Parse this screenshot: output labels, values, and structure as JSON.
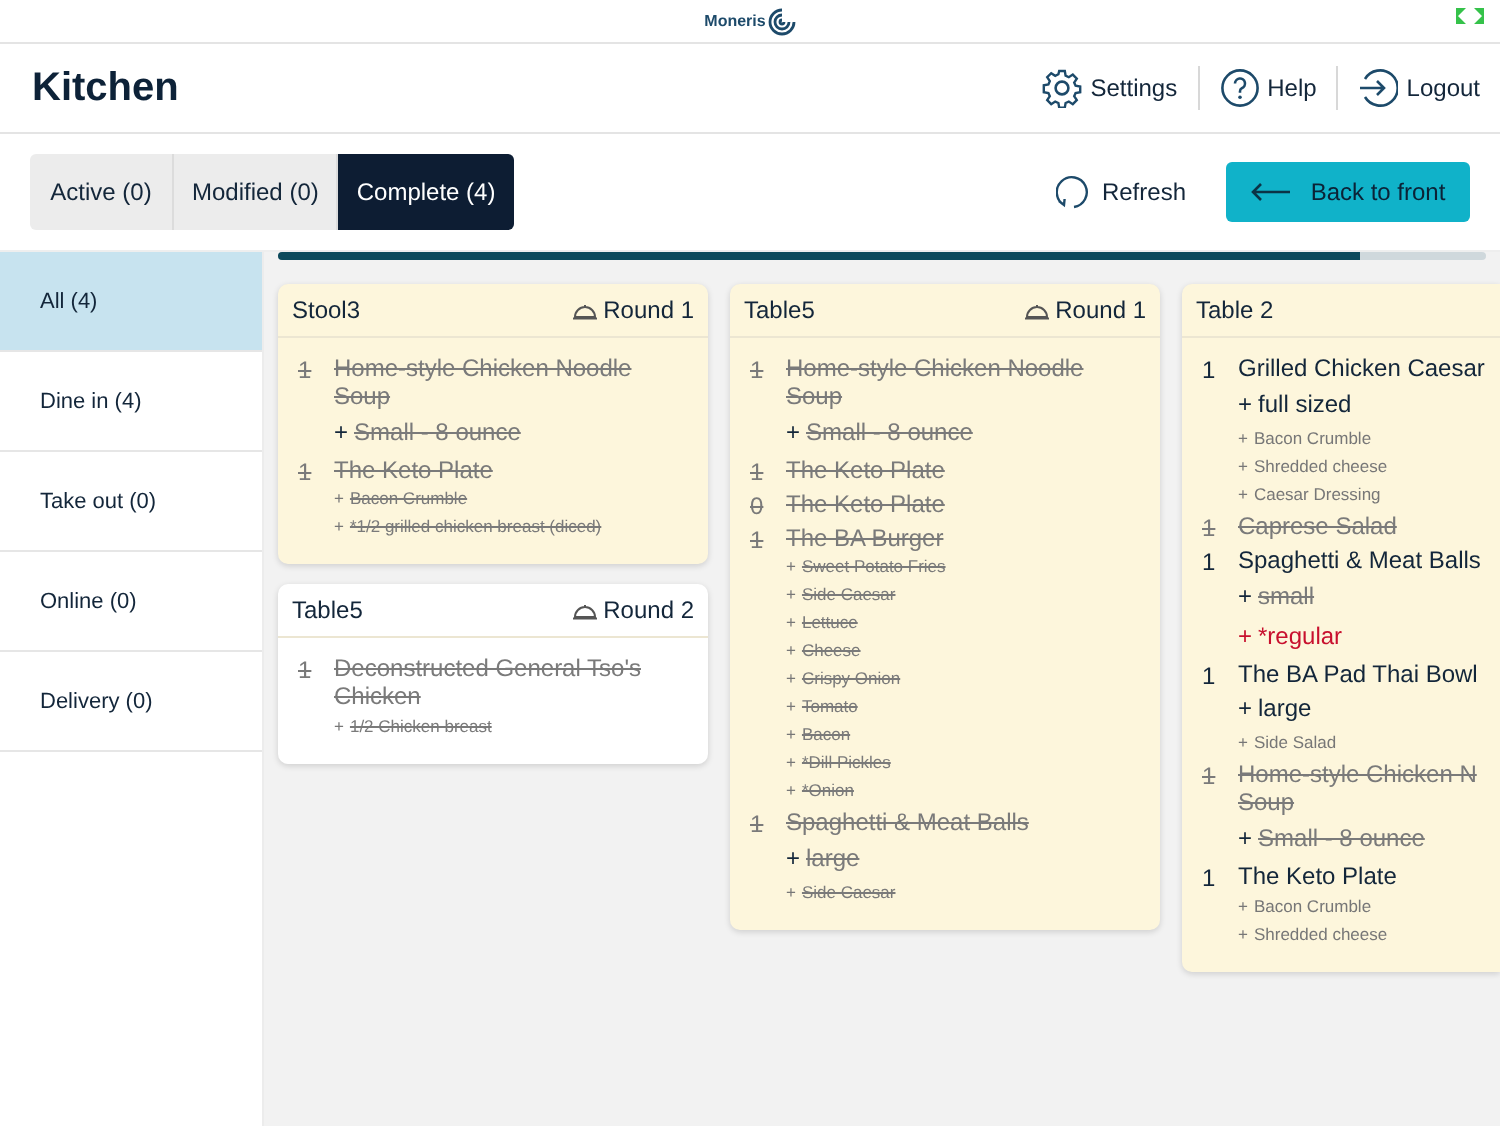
{
  "top_bar": {
    "brand": "Moneris"
  },
  "header": {
    "title": "Kitchen",
    "actions": [
      {
        "kind": "settings",
        "label": "Settings"
      },
      {
        "kind": "help",
        "label": "Help"
      },
      {
        "kind": "logout",
        "label": "Logout"
      }
    ]
  },
  "tabs": [
    {
      "label": "Active (0)",
      "selected": false
    },
    {
      "label": "Modified (0)",
      "selected": false
    },
    {
      "label": "Complete (4)",
      "selected": true
    }
  ],
  "refresh": {
    "label": "Refresh"
  },
  "back_button": {
    "label": "Back to front"
  },
  "progress": {
    "level": 0.895
  },
  "sidebar": {
    "items": [
      {
        "label": "All (4)",
        "selected": true
      },
      {
        "label": "Dine in (4)",
        "selected": false
      },
      {
        "label": "Take out (0)",
        "selected": false
      },
      {
        "label": "Online (0)",
        "selected": false
      },
      {
        "label": "Delivery (0)",
        "selected": false
      }
    ]
  },
  "columns": [
    {
      "cards": [
        {
          "title": "Stool3",
          "round": "Round 1",
          "highlighted": true,
          "items": [
            {
              "qty": "1",
              "name": "Home-style Chicken Noodle Soup",
              "struck": true,
              "modifiers": [
                {
                  "prefix": "+",
                  "text": "Small - 8 ounce",
                  "kind": "variant",
                  "struck": true
                }
              ]
            },
            {
              "qty": "1",
              "name": "The Keto Plate",
              "struck": true,
              "modifiers": [
                {
                  "prefix": "+",
                  "text": "Bacon Crumble",
                  "kind": "option",
                  "struck": true
                },
                {
                  "prefix": "+",
                  "text": "*1/2 grilled chicken breast (diced)",
                  "kind": "option",
                  "struck": true
                }
              ]
            }
          ]
        },
        {
          "title": "Table5",
          "round": "Round 2",
          "highlighted": false,
          "items": [
            {
              "qty": "1",
              "name": "Deconstructed General Tso's Chicken",
              "struck": true,
              "modifiers": [
                {
                  "prefix": "+",
                  "text": "1/2 Chicken breast",
                  "kind": "option",
                  "struck": true
                }
              ]
            }
          ]
        }
      ]
    },
    {
      "cards": [
        {
          "title": "Table5",
          "round": "Round 1",
          "highlighted": true,
          "items": [
            {
              "qty": "1",
              "name": "Home-style Chicken Noodle Soup",
              "struck": true,
              "modifiers": [
                {
                  "prefix": "+",
                  "text": "Small - 8 ounce",
                  "kind": "variant",
                  "struck": true
                }
              ]
            },
            {
              "qty": "1",
              "name": "The Keto Plate",
              "struck": true
            },
            {
              "qty": "0",
              "name": "The Keto Plate",
              "struck": true
            },
            {
              "qty": "1",
              "name": "The BA Burger",
              "struck": true,
              "modifiers": [
                {
                  "prefix": "+",
                  "text": "Sweet Potato Fries",
                  "kind": "option",
                  "struck": true
                },
                {
                  "prefix": "+",
                  "text": "Side Caesar",
                  "kind": "option",
                  "struck": true
                },
                {
                  "prefix": "+",
                  "text": "Lettuce",
                  "kind": "option",
                  "struck": true
                },
                {
                  "prefix": "+",
                  "text": "Cheese",
                  "kind": "option",
                  "struck": true
                },
                {
                  "prefix": "+",
                  "text": "Crispy Onion",
                  "kind": "option",
                  "struck": true
                },
                {
                  "prefix": "+",
                  "text": "Tomato",
                  "kind": "option",
                  "struck": true
                },
                {
                  "prefix": "+",
                  "text": "Bacon",
                  "kind": "option",
                  "struck": true
                },
                {
                  "prefix": "+",
                  "text": "*Dill Pickles",
                  "kind": "option",
                  "struck": true
                },
                {
                  "prefix": "+",
                  "text": "*Onion",
                  "kind": "option",
                  "struck": true
                }
              ]
            },
            {
              "qty": "1",
              "name": "Spaghetti & Meat Balls",
              "struck": true,
              "modifiers": [
                {
                  "prefix": "+",
                  "text": "large",
                  "kind": "variant",
                  "struck": true
                },
                {
                  "prefix": "+",
                  "text": "Side Caesar",
                  "kind": "option",
                  "struck": true
                }
              ]
            }
          ]
        }
      ]
    },
    {
      "cards": [
        {
          "title": "Table 2",
          "highlighted": true,
          "items": [
            {
              "qty": "1",
              "name": "Grilled Chicken Caesar",
              "struck": false,
              "modifiers": [
                {
                  "prefix": "+",
                  "text": "full sized",
                  "kind": "variant",
                  "struck": false
                },
                {
                  "prefix": "+",
                  "text": "Bacon Crumble",
                  "kind": "option",
                  "struck": false
                },
                {
                  "prefix": "+",
                  "text": "Shredded cheese",
                  "kind": "option",
                  "struck": false
                },
                {
                  "prefix": "+",
                  "text": "Caesar Dressing",
                  "kind": "option",
                  "struck": false
                }
              ]
            },
            {
              "qty": "1",
              "name": "Caprese Salad",
              "struck": true
            },
            {
              "qty": "1",
              "name": "Spaghetti & Meat Balls",
              "struck": false,
              "modifiers": [
                {
                  "prefix": "+",
                  "text": "small",
                  "kind": "variant",
                  "struck": true
                },
                {
                  "prefix": "+",
                  "text": "*regular",
                  "kind": "added",
                  "struck": false
                }
              ]
            },
            {
              "qty": "1",
              "name": "The BA Pad Thai Bowl",
              "struck": false,
              "modifiers": [
                {
                  "prefix": "+",
                  "text": "large",
                  "kind": "variant",
                  "struck": false
                },
                {
                  "prefix": "+",
                  "text": "Side Salad",
                  "kind": "option",
                  "struck": false
                }
              ]
            },
            {
              "qty": "1",
              "name": "Home-style Chicken N Soup",
              "struck": true,
              "modifiers": [
                {
                  "prefix": "+",
                  "text": "Small - 8 ounce",
                  "kind": "variant",
                  "struck": true
                }
              ]
            },
            {
              "qty": "1",
              "name": "The Keto Plate",
              "struck": false,
              "modifiers": [
                {
                  "prefix": "+",
                  "text": "Bacon Crumble",
                  "kind": "option",
                  "struck": false
                },
                {
                  "prefix": "+",
                  "text": "Shredded cheese",
                  "kind": "option",
                  "struck": false
                }
              ]
            }
          ]
        }
      ]
    }
  ]
}
